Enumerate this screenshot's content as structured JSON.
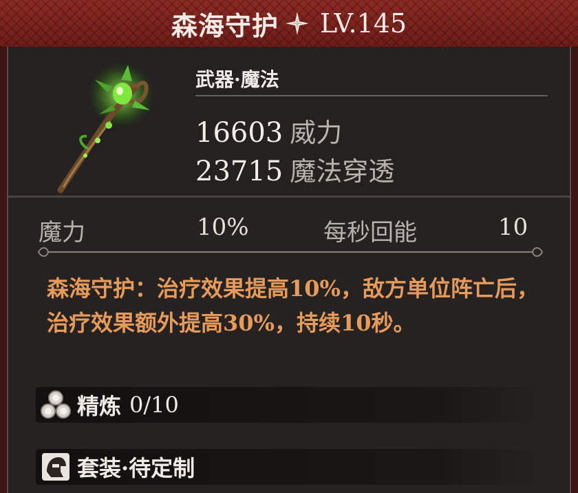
{
  "header": {
    "name": "森海守护",
    "level": "LV.145",
    "star_icon": "four-point-star-icon"
  },
  "item": {
    "type": "武器·魔法",
    "image_icon": "staff-icon",
    "stats": [
      {
        "value": "16603",
        "label": "威力"
      },
      {
        "value": "23715",
        "label": "魔法穿透"
      }
    ]
  },
  "attributes": {
    "left_label": "魔力",
    "left_value": "10%",
    "right_label": "每秒回能",
    "right_value": "10"
  },
  "skill": {
    "description": "森海守护：治疗效果提高10%，敌方单位阵亡后，治疗效果额外提高30%，持续10秒。"
  },
  "refine": {
    "label": "精炼",
    "count": "0/10",
    "icon": "refine-orbs-icon"
  },
  "set": {
    "label": "套装·待定制",
    "icon": "helmet-icon"
  },
  "colors": {
    "header_red": "#8c2a24",
    "skill_orange": "#e79b5a",
    "panel_dark": "#262222"
  }
}
